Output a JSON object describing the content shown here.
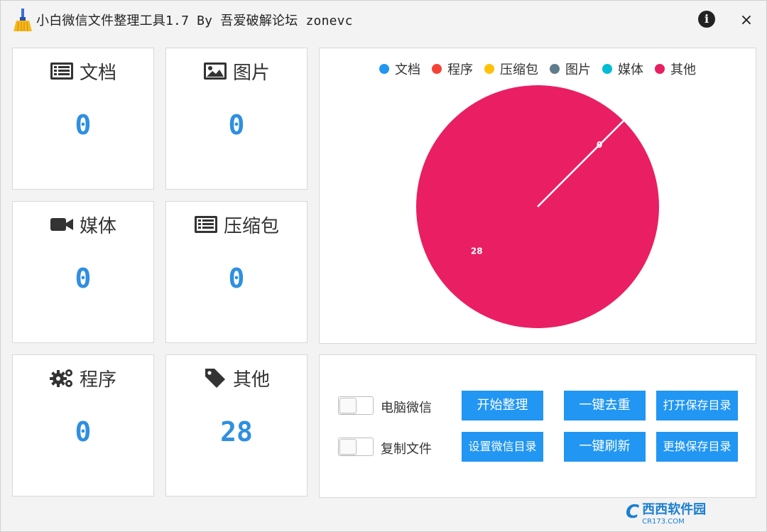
{
  "window": {
    "title": "小白微信文件整理工具1.7 By 吾爱破解论坛 zonevc",
    "info_label": "i",
    "close_label": "×"
  },
  "cards": {
    "docs": {
      "label": "文档",
      "value": "0",
      "icon": "document-list-icon"
    },
    "images": {
      "label": "图片",
      "value": "0",
      "icon": "image-icon"
    },
    "media": {
      "label": "媒体",
      "value": "0",
      "icon": "video-camera-icon"
    },
    "archives": {
      "label": "压缩包",
      "value": "0",
      "icon": "archive-list-icon"
    },
    "programs": {
      "label": "程序",
      "value": "0",
      "icon": "gears-icon"
    },
    "others": {
      "label": "其他",
      "value": "28",
      "icon": "tag-icon"
    }
  },
  "chart_data": {
    "type": "pie",
    "legend_position": "top",
    "categories": [
      "文档",
      "程序",
      "压缩包",
      "图片",
      "媒体",
      "其他"
    ],
    "values": [
      0,
      0,
      0,
      0,
      0,
      28
    ],
    "colors": [
      "#2196f3",
      "#f44336",
      "#ffc107",
      "#607d8b",
      "#00bcd4",
      "#e91e63"
    ],
    "slice_labels": [
      "0",
      "28"
    ]
  },
  "controls": {
    "toggle_pc_wechat": {
      "label": "电脑微信",
      "on": false
    },
    "toggle_copy_files": {
      "label": "复制文件",
      "on": false
    },
    "buttons": {
      "start": "开始整理",
      "dedupe": "一键去重",
      "open_save_dir": "打开保存目录",
      "set_wechat_dir": "设置微信目录",
      "refresh": "一键刷新",
      "change_save_dir": "更换保存目录"
    }
  },
  "watermark": {
    "logo": "C",
    "name": "西西软件园",
    "url": "CR173.COM"
  }
}
